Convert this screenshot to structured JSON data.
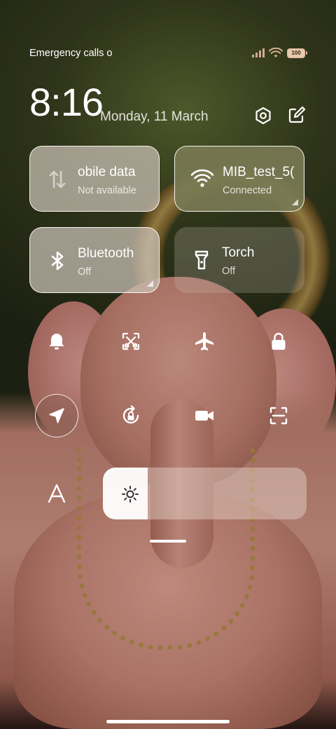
{
  "status_bar": {
    "carrier_text": "Emergency calls o",
    "battery_level": "100",
    "signal_icon": "signal-icon",
    "wifi_icon": "wifi-icon"
  },
  "header": {
    "time": "8:16",
    "date": "Monday, 11 March",
    "settings_icon": "settings-icon",
    "edit_icon": "edit-icon"
  },
  "tiles": [
    {
      "id": "mobile-data",
      "title": "obile data",
      "subtitle": "Not available",
      "state": "inactive",
      "icon": "mobile-data-icon"
    },
    {
      "id": "wifi",
      "title": "MIB_test_5(",
      "subtitle": "Connected",
      "state": "active",
      "icon": "wifi-icon"
    },
    {
      "id": "bluetooth",
      "title": "Bluetooth",
      "subtitle": "Off",
      "state": "inactive",
      "icon": "bluetooth-icon"
    },
    {
      "id": "torch",
      "title": "Torch",
      "subtitle": "Off",
      "state": "faded",
      "icon": "torch-icon"
    }
  ],
  "toggles_row1": [
    "bell-icon",
    "screenshot-icon",
    "airplane-icon",
    "lock-icon"
  ],
  "toggles_row2": [
    "location-icon",
    "rotation-lock-icon",
    "video-camera-icon",
    "scan-icon"
  ],
  "brightness": {
    "level": 0.22,
    "auto_icon": "auto-brightness-icon",
    "sun_icon": "sun-icon"
  },
  "colors": {
    "active_tile": "#787a54",
    "inactive_tile": "#cdc3b9"
  }
}
